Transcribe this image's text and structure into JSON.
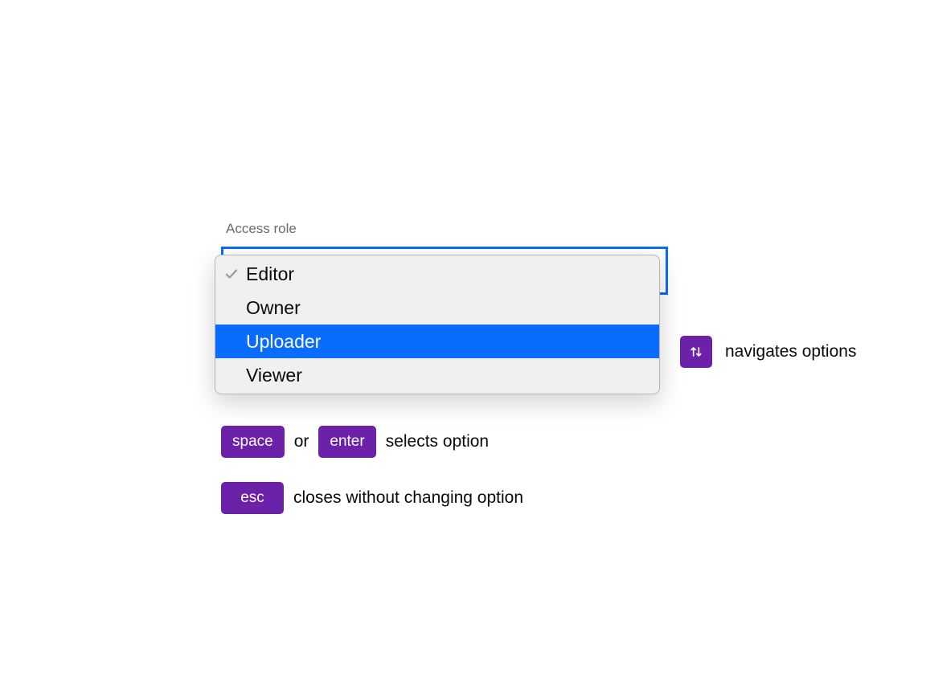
{
  "field": {
    "label": "Access role"
  },
  "dropdown": {
    "options": [
      {
        "label": "Editor",
        "checked": true,
        "highlighted": false
      },
      {
        "label": "Owner",
        "checked": false,
        "highlighted": false
      },
      {
        "label": "Uploader",
        "checked": false,
        "highlighted": true
      },
      {
        "label": "Viewer",
        "checked": false,
        "highlighted": false
      }
    ]
  },
  "hints": {
    "navigate": {
      "text": "navigates options"
    },
    "select": {
      "key1": "space",
      "connector": "or",
      "key2": "enter",
      "text": "selects option"
    },
    "close": {
      "key": "esc",
      "text": "closes without changing option"
    }
  },
  "colors": {
    "focus_border": "#0a6bff",
    "highlight_bg": "#0a6bff",
    "key_badge_bg": "#6b21a8"
  }
}
